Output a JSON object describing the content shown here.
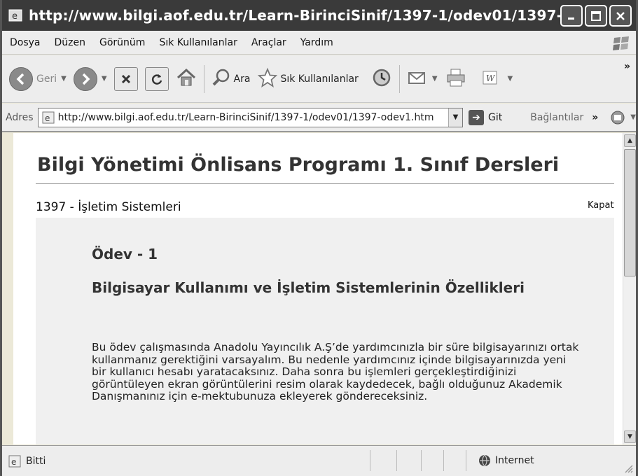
{
  "window": {
    "title": "http://www.bilgi.aof.edu.tr/Learn-BirinciSinif/1397-1/odev01/1397-odev1.ht...",
    "controls": [
      "minimize",
      "maximize",
      "close"
    ]
  },
  "menubar": {
    "items": [
      {
        "label": "Dosya"
      },
      {
        "label": "Düzen"
      },
      {
        "label": "Görünüm"
      },
      {
        "label": "Sık Kullanılanlar"
      },
      {
        "label": "Araçlar"
      },
      {
        "label": "Yardım"
      }
    ]
  },
  "toolbar": {
    "back_label": "Geri",
    "search_label": "Ara",
    "favorites_label": "Sık Kullanılanlar",
    "overflow": "»"
  },
  "addressbar": {
    "label": "Adres",
    "url": "http://www.bilgi.aof.edu.tr/Learn-BirinciSinif/1397-1/odev01/1397-odev1.htm",
    "go_label": "Git",
    "links_label": "Bağlantılar",
    "links_overflow": "»"
  },
  "page": {
    "title": "Bilgi Yönetimi Önlisans Programı 1. Sınıf Dersleri",
    "course": "1397 - İşletim Sistemleri",
    "close_link": "Kapat",
    "homework_heading": "Ödev - 1",
    "homework_title": "Bilgisayar Kullanımı ve İşletim Sistemlerinin Özellikleri",
    "body": "Bu ödev çalışmasında Anadolu Yayıncılık A.Ş’de yardımcınızla bir süre bilgisayarınızı ortak kullanmanız gerektiğini varsayalım. Bu nedenle yardımcınız içinde bilgisayarınızda yeni bir kullanıcı hesabı yaratacaksınız. Daha sonra bu işlemleri gerçekleştirdiğinizi görüntüleyen ekran görüntülerini resim olarak kaydedecek, bağlı olduğunuz Akademik Danışmanınız için e-mektubunuza ekleyerek göndereceksiniz."
  },
  "statusbar": {
    "status": "Bitti",
    "zone": "Internet"
  },
  "colors": {
    "titlebar": "#3a3a3a",
    "chrome": "#ededed",
    "panel": "#f0f0f0"
  }
}
